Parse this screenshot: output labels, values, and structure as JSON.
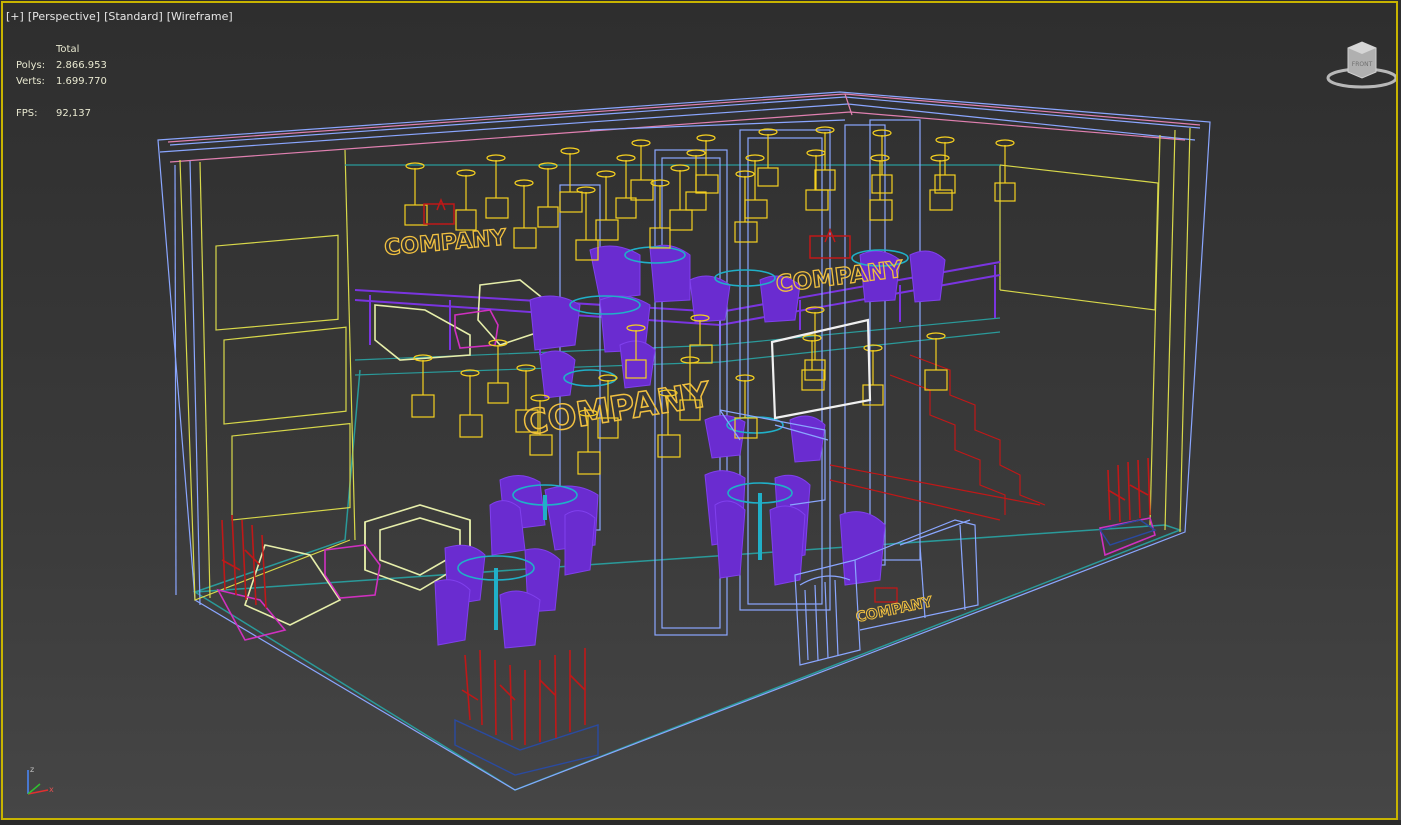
{
  "viewport": {
    "labels": [
      "[+]",
      "[Perspective]",
      "[Standard]",
      "[Wireframe]"
    ],
    "stats": {
      "header": "Total",
      "rows": [
        {
          "key": "Polys:",
          "value": "2.866.953"
        },
        {
          "key": "Verts:",
          "value": "1.699.770"
        }
      ],
      "fps_key": "FPS:",
      "fps_value": "92,137"
    },
    "signs": [
      "COMPANY",
      "COMPANY",
      "COMPANY",
      "COMPANY"
    ],
    "viewcube_label": "FRONT",
    "axis": {
      "x": "x",
      "z": "z"
    }
  },
  "colors": {
    "frame": "#c8b400",
    "walls": "#d8d84a",
    "structure": "#8aa6ff",
    "chairs": "#6a2cd0",
    "lamps": "#f5d020",
    "plants": "#c01818",
    "sofas": "#e6eeaa",
    "tables": "#20b0c8",
    "stairs": "#c01818",
    "sign": "#f0c040"
  }
}
